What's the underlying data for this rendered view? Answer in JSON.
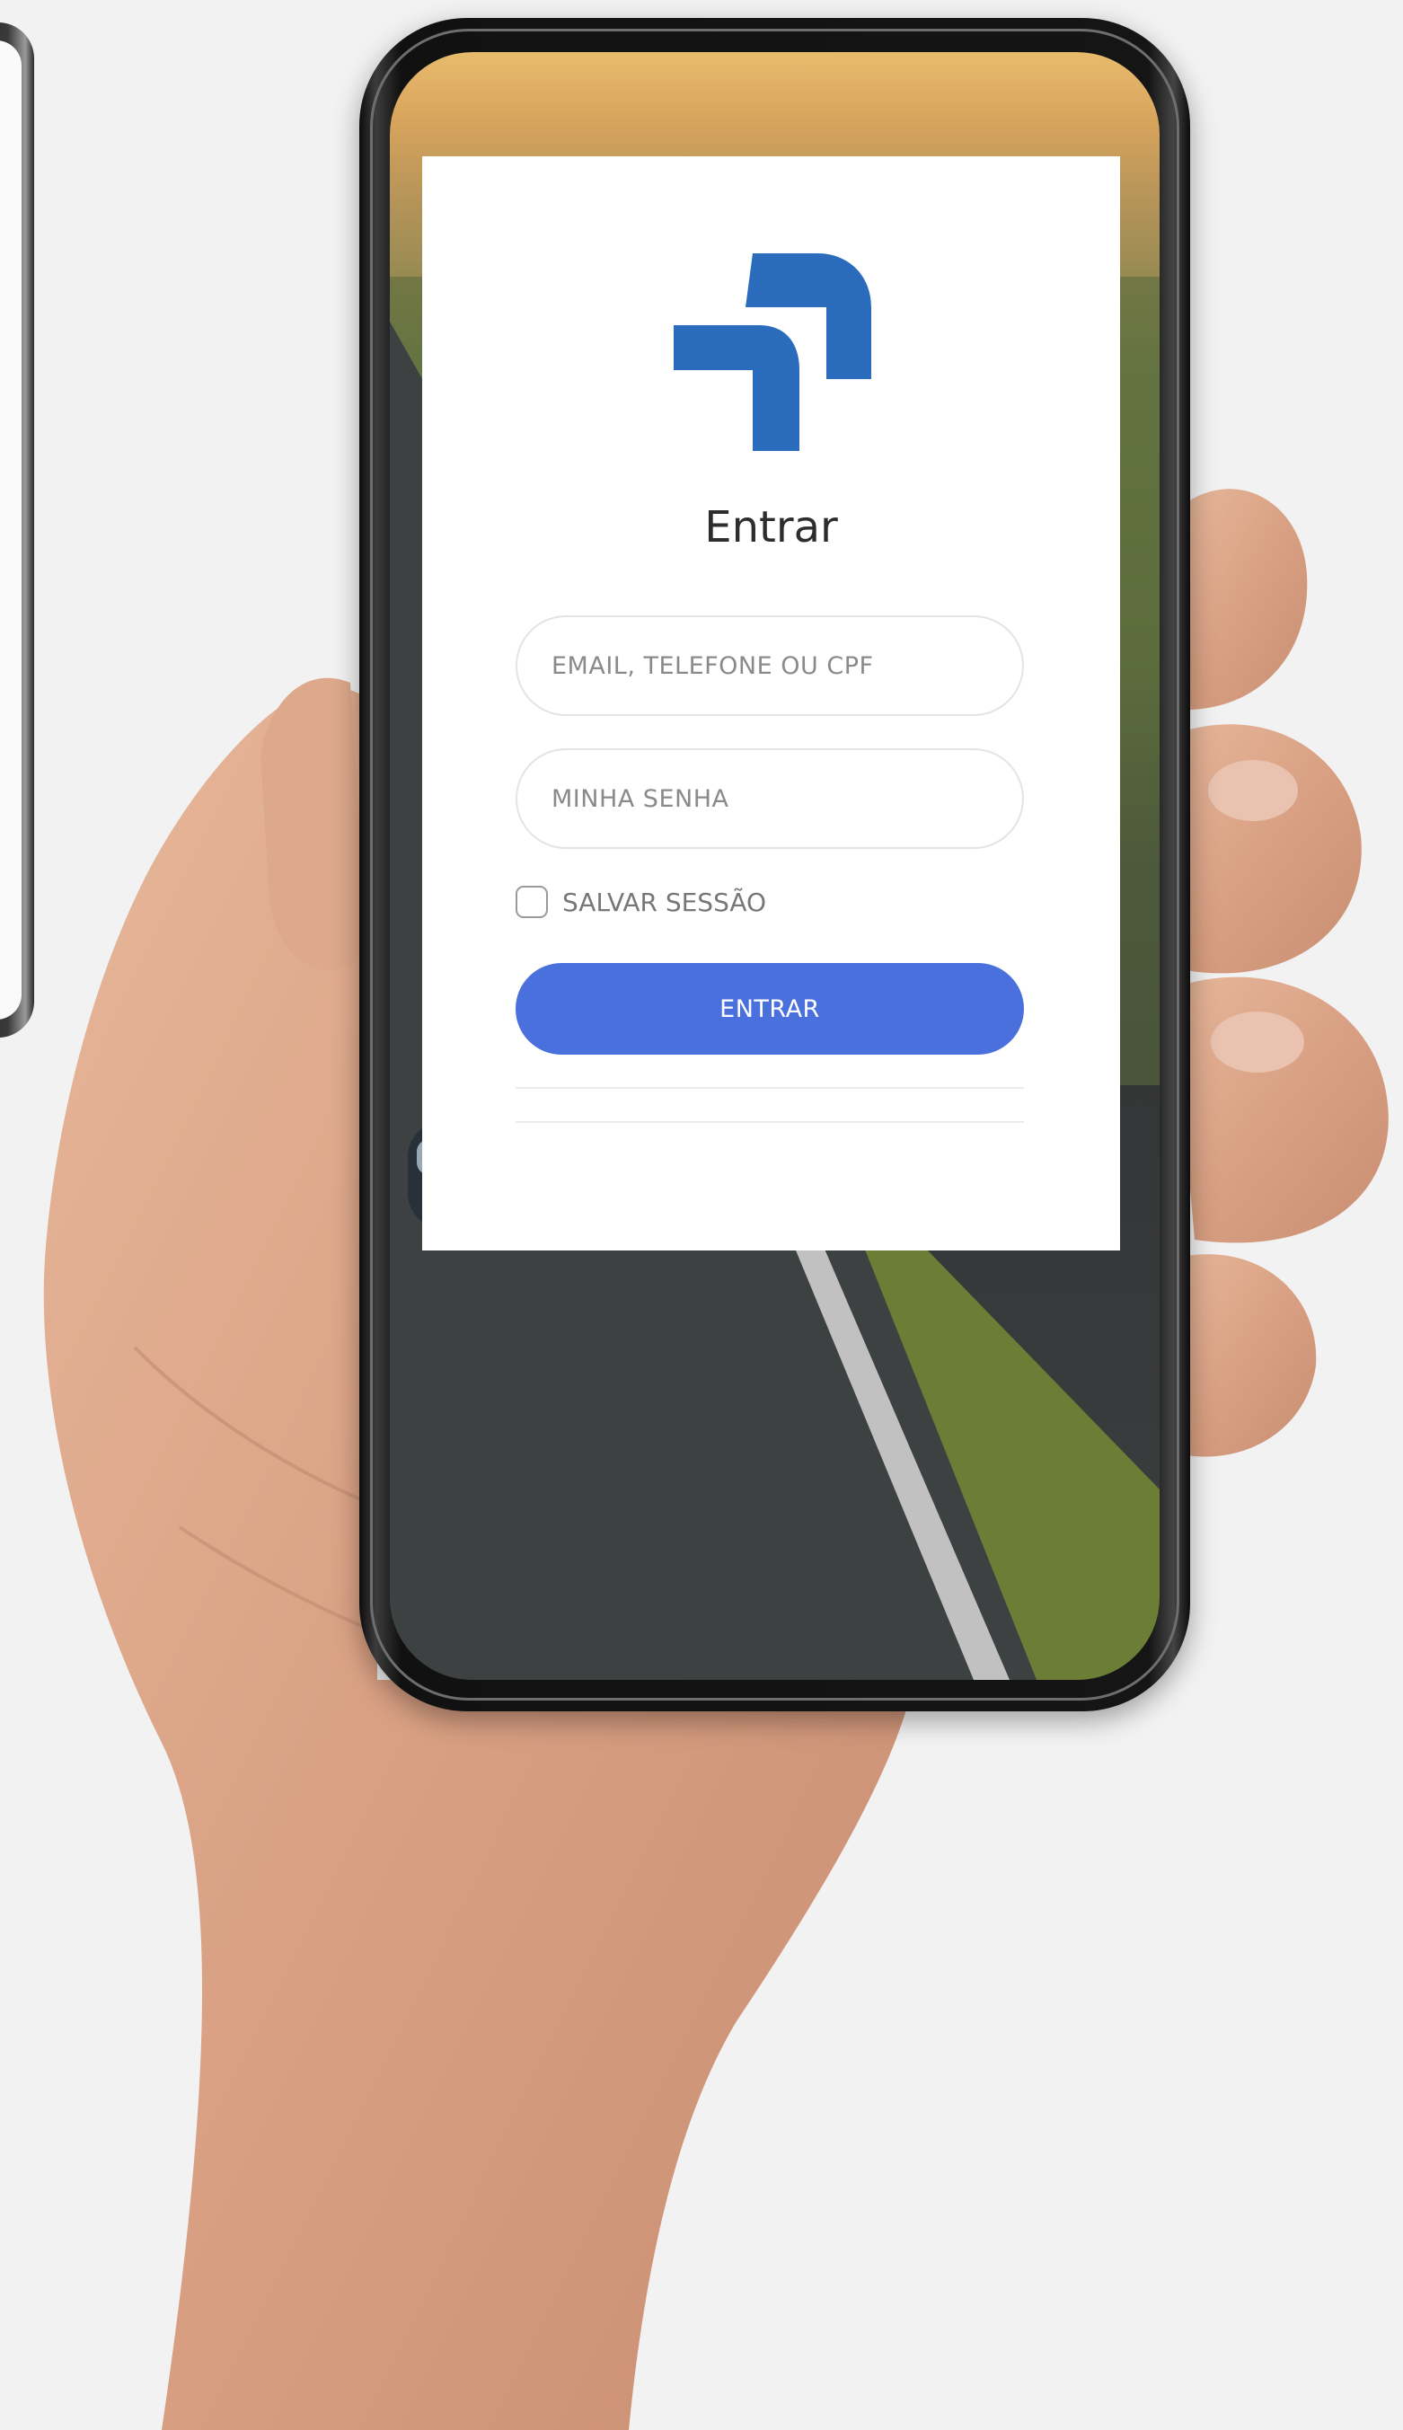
{
  "login": {
    "title": "Entrar",
    "email_placeholder": "EMAIL, TELEFONE OU CPF",
    "password_placeholder": "MINHA SENHA",
    "remember_label": "SALVAR SESSÃO",
    "remember_checked": false,
    "submit_label": "ENTRAR"
  },
  "colors": {
    "accent": "#4a70de",
    "logo": "#2a6cbb",
    "background": "#f2f2f3"
  },
  "icons": {
    "logo": "brand-logo-icon"
  }
}
